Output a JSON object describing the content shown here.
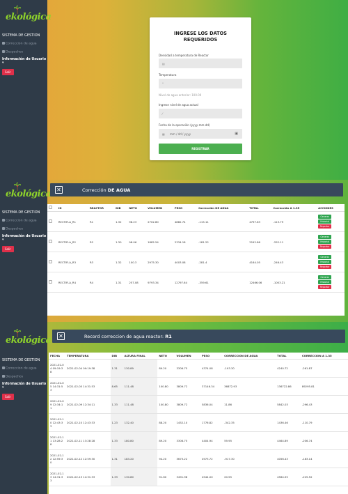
{
  "brand": {
    "name": "ekológica"
  },
  "sidebar": {
    "title": "SISTEMA DE GESTION",
    "item1": "Correccion de agua",
    "item2": "Despachos",
    "user": "Información de Usuario ▾",
    "logout": "Salir"
  },
  "form": {
    "title": "INGRESE LOS DATOS REQUERIDOS",
    "density_label": "Densidad a temperatura de Reactor",
    "temp_label": "Temperatura",
    "water_prev": "Nivel de agua anterior: 100.00",
    "water_label": "Ingrese nivel de agua actual",
    "date_label": "Fecha de la operación (yyyy-mm-dd)",
    "date_placeholder": "mm / dd / yyyy",
    "submit": "REGISTRAR"
  },
  "correction": {
    "title_pre": "Corrección",
    "title_bold": "DE AGUA",
    "columns": [
      "ID",
      "REACTOR",
      "DIB",
      "NETO",
      "VOLUMEN",
      "PESO",
      "Corrección DE AGUA",
      "TOTAL",
      "Corrección A 1.35",
      "ACCIONES"
    ],
    "rows": [
      [
        "RECTIFLA_R1",
        "R1",
        "1.32",
        "98.23",
        "2702.80",
        "4882.74",
        "-115.11",
        "4797.63",
        "-113.79"
      ],
      [
        "RECTIFLA_R2",
        "R2",
        "1.30",
        "98.06",
        "1882.54",
        "2334.18",
        "-181.22",
        "2242.86",
        "-252.11"
      ],
      [
        "RECTIFLA_R3",
        "R3",
        "1.32",
        "100.3",
        "2975.30",
        "4003.08",
        "-281.4",
        "4164.05",
        "-246.43"
      ],
      [
        "RECTIFLA_R4",
        "R4",
        "1.31",
        "257.08",
        "9793.34",
        "12797.64",
        "-359.61",
        "12466.06",
        "-1003.21"
      ]
    ],
    "actions": [
      "Generar",
      "Historial",
      "Reportar"
    ]
  },
  "record": {
    "title_pre": "Record correccion de agua reactor:",
    "title_bold": "R1",
    "columns": [
      "FECHA",
      "TEMPERATURA",
      "DIB",
      "ALTURA FINAL",
      "NETO",
      "VOLUMEN",
      "PESO",
      "CORRECCION DE AGUA",
      "TOTAL",
      "CORRECCION A 1.35"
    ],
    "rows": [
      [
        "2021-02-04 09:19:38",
        "2021-02-04 09:19:38",
        "1.31",
        "130.89",
        "89.20",
        "3306.75",
        "4374.08",
        "-193.30",
        "4240.72",
        "-261.87"
      ],
      [
        "2021-02-05 14:31:53",
        "2021-02-05 14:31:53",
        "8.65",
        "111.48",
        "100.80",
        "3809.72",
        "37146.34",
        "36872.93",
        "136722.86",
        "89295.81"
      ],
      [
        "2021-02-09 12:34:11",
        "2021-02-09 12:34:11",
        "1.33",
        "111.48",
        "100.80",
        "3809.72",
        "5836.04",
        "11.86",
        "5842.03",
        "-296.43"
      ],
      [
        "2021-02-10 12:43:33",
        "2021-02-10 12:43:33",
        "1.23",
        "132.40",
        "88.20",
        "1452.10",
        "1776.82",
        "-342.35",
        "1436.46",
        "-110.79"
      ],
      [
        "2021-02-11 13:28:28",
        "2021-02-11 13:28:28",
        "1.33",
        "180.80",
        "89.20",
        "3306.75",
        "4404.94",
        "59.95",
        "4464.89",
        "-206.74"
      ],
      [
        "2021-02-12 12:59:30",
        "2021-02-12 12:59:30",
        "1.31",
        "183.20",
        "94.20",
        "3673.22",
        "4973.72",
        "-917.30",
        "4056.43",
        "-183.14"
      ],
      [
        "2021-02-13 14:31:33",
        "2021-02-13 14:31:33",
        "1.33",
        "130.80",
        "91.60",
        "3491.98",
        "4544.00",
        "20.55",
        "4564.55",
        "-225.52"
      ]
    ]
  }
}
